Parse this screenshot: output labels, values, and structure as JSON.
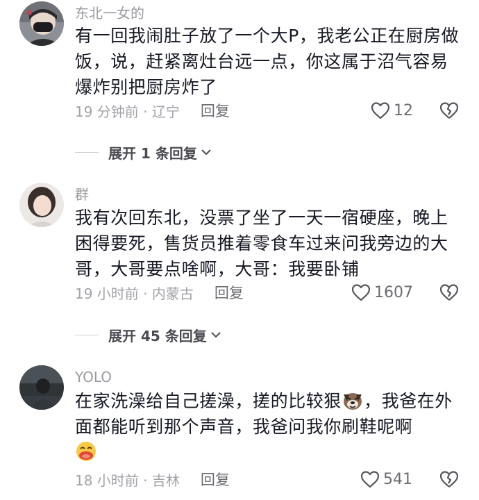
{
  "comments": [
    {
      "username": "东北一女的",
      "text": "有一回我闹肚子放了一个大P，我老公正在厨房做饭，说，赶紧离灶台远一点，你这属于沼气容易爆炸别把厨房炸了",
      "time_location": "19 分钟前 · 辽宁",
      "reply_label": "回复",
      "likes": "12",
      "expand_label": "展开 1 条回复"
    },
    {
      "username": "群",
      "text": "我有次回东北，没票了坐了一天一宿硬座，晚上困得要死，售货员推着零食车过来问我旁边的大哥，大哥要点啥啊，大哥：我要卧铺",
      "time_location": "19 小时前 · 内蒙古",
      "reply_label": "回复",
      "likes": "1607",
      "expand_label": "展开 45 条回复"
    },
    {
      "username": "YOLO",
      "text_part1": "在家洗澡给自己搓澡，搓的比较狠",
      "text_part2": "，我爸在外面都能听到那个声音，我爸问我你刷鞋呢啊",
      "time_location": "18 小时前 · 吉林",
      "reply_label": "回复",
      "likes": "541"
    }
  ],
  "icons": {
    "like": "heart-outline-icon",
    "dislike": "broken-heart-icon",
    "expand": "chevron-down-icon",
    "emoji_1": "dog-face-emoji",
    "emoji_2": "laughing-tongue-emoji"
  }
}
